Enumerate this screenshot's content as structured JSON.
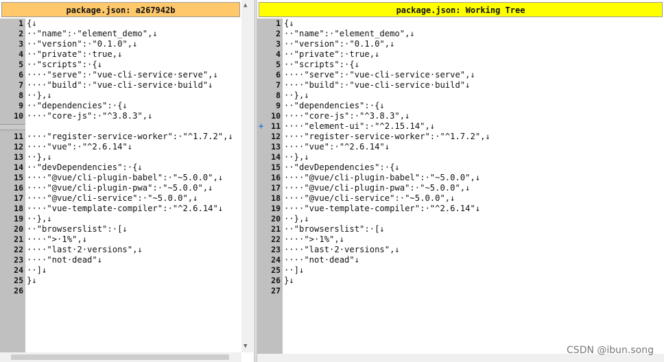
{
  "left": {
    "title": "package.json: a267942b",
    "rows": [
      {
        "n": "1",
        "t": "{↓"
      },
      {
        "n": "2",
        "t": "··\"name\":·\"element_demo\",↓"
      },
      {
        "n": "3",
        "t": "··\"version\":·\"0.1.0\",↓"
      },
      {
        "n": "4",
        "t": "··\"private\":·true,↓"
      },
      {
        "n": "5",
        "t": "··\"scripts\":·{↓"
      },
      {
        "n": "6",
        "t": "····\"serve\":·\"vue-cli-service·serve\",↓"
      },
      {
        "n": "7",
        "t": "····\"build\":·\"vue-cli-service·build\"↓"
      },
      {
        "n": "8",
        "t": "··},↓"
      },
      {
        "n": "9",
        "t": "··\"dependencies\":·{↓"
      },
      {
        "n": "10",
        "t": "····\"core-js\":·\"^3.8.3\",↓"
      },
      {
        "placeholder": true
      },
      {
        "n": "11",
        "t": "····\"register-service-worker\":·\"^1.7.2\",↓"
      },
      {
        "n": "12",
        "t": "····\"vue\":·\"^2.6.14\"↓"
      },
      {
        "n": "13",
        "t": "··},↓"
      },
      {
        "n": "14",
        "t": "··\"devDependencies\":·{↓"
      },
      {
        "n": "15",
        "t": "····\"@vue/cli-plugin-babel\":·\"~5.0.0\",↓"
      },
      {
        "n": "16",
        "t": "····\"@vue/cli-plugin-pwa\":·\"~5.0.0\",↓"
      },
      {
        "n": "17",
        "t": "····\"@vue/cli-service\":·\"~5.0.0\",↓"
      },
      {
        "n": "18",
        "t": "····\"vue-template-compiler\":·\"^2.6.14\"↓"
      },
      {
        "n": "19",
        "t": "··},↓"
      },
      {
        "n": "20",
        "t": "··\"browserslist\":·[↓"
      },
      {
        "n": "21",
        "t": "····\">·1%\",↓"
      },
      {
        "n": "22",
        "t": "····\"last·2·versions\",↓"
      },
      {
        "n": "23",
        "t": "····\"not·dead\"↓"
      },
      {
        "n": "24",
        "t": "··]↓"
      },
      {
        "n": "25",
        "t": "}↓"
      },
      {
        "n": "26",
        "t": ""
      }
    ]
  },
  "right": {
    "title": "package.json: Working Tree",
    "add_marker": "+",
    "rows": [
      {
        "n": "1",
        "t": "{↓"
      },
      {
        "n": "2",
        "t": "··\"name\":·\"element_demo\",↓"
      },
      {
        "n": "3",
        "t": "··\"version\":·\"0.1.0\",↓"
      },
      {
        "n": "4",
        "t": "··\"private\":·true,↓"
      },
      {
        "n": "5",
        "t": "··\"scripts\":·{↓"
      },
      {
        "n": "6",
        "t": "····\"serve\":·\"vue-cli-service·serve\",↓"
      },
      {
        "n": "7",
        "t": "····\"build\":·\"vue-cli-service·build\"↓"
      },
      {
        "n": "8",
        "t": "··},↓"
      },
      {
        "n": "9",
        "t": "··\"dependencies\":·{↓"
      },
      {
        "n": "10",
        "t": "····\"core-js\":·\"^3.8.3\",↓"
      },
      {
        "n": "11",
        "t": "····\"element-ui\":·\"^2.15.14\",↓",
        "added": true
      },
      {
        "n": "12",
        "t": "····\"register-service-worker\":·\"^1.7.2\",↓"
      },
      {
        "n": "13",
        "t": "····\"vue\":·\"^2.6.14\"↓"
      },
      {
        "n": "14",
        "t": "··},↓"
      },
      {
        "n": "15",
        "t": "··\"devDependencies\":·{↓"
      },
      {
        "n": "16",
        "t": "····\"@vue/cli-plugin-babel\":·\"~5.0.0\",↓"
      },
      {
        "n": "17",
        "t": "····\"@vue/cli-plugin-pwa\":·\"~5.0.0\",↓"
      },
      {
        "n": "18",
        "t": "····\"@vue/cli-service\":·\"~5.0.0\",↓"
      },
      {
        "n": "19",
        "t": "····\"vue-template-compiler\":·\"^2.6.14\"↓"
      },
      {
        "n": "20",
        "t": "··},↓"
      },
      {
        "n": "21",
        "t": "··\"browserslist\":·[↓"
      },
      {
        "n": "22",
        "t": "····\">·1%\",↓"
      },
      {
        "n": "23",
        "t": "····\"last·2·versions\",↓"
      },
      {
        "n": "24",
        "t": "····\"not·dead\"↓"
      },
      {
        "n": "25",
        "t": "··]↓"
      },
      {
        "n": "26",
        "t": "}↓"
      },
      {
        "n": "27",
        "t": ""
      }
    ]
  },
  "scroll": {
    "up_icon": "▲",
    "down_icon": "▼"
  },
  "watermark": "CSDN @ibun.song",
  "colors": {
    "left_header": "#ffc86a",
    "right_header": "#ffff00",
    "added_line": "#ffff00",
    "gutter": "#c0c0c0"
  }
}
